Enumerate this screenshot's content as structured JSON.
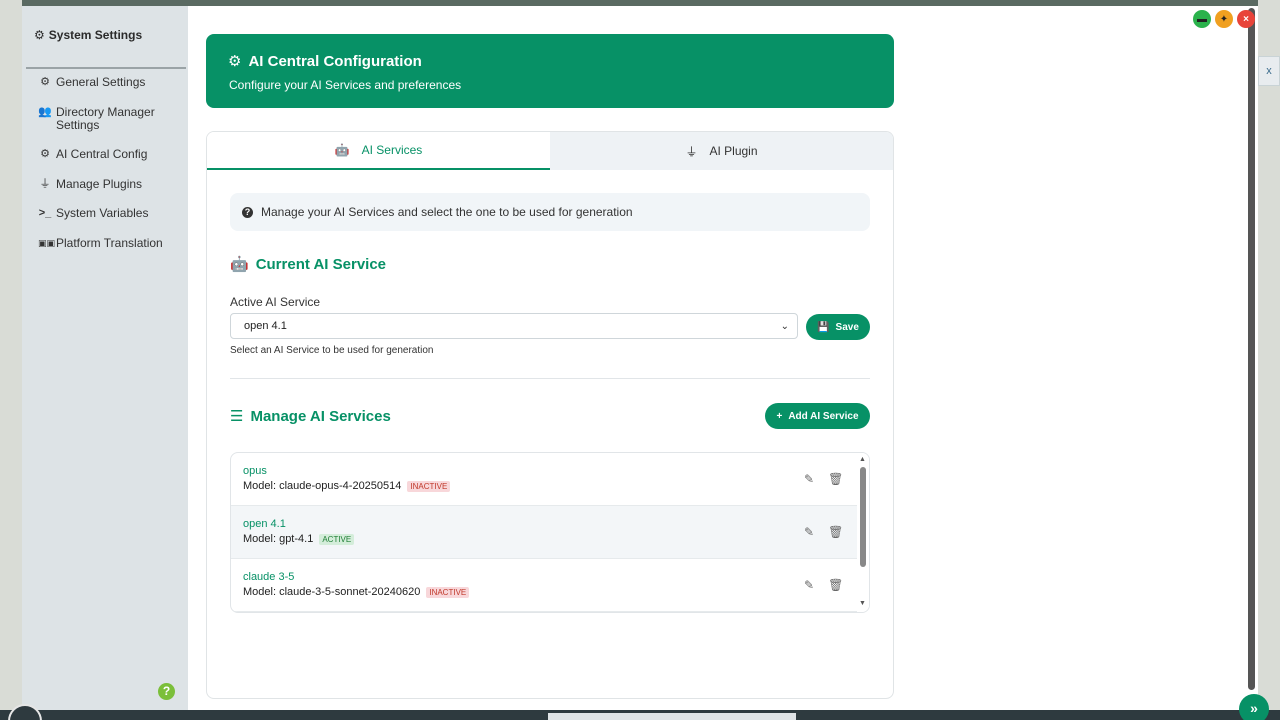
{
  "window": {
    "minimize_icon": "minimize-icon",
    "pin_icon": "pin-icon",
    "close_glyph": "×"
  },
  "background": {
    "right_tab_label": "x"
  },
  "sidebar": {
    "title": "System Settings",
    "items": [
      {
        "label": "General Settings",
        "icon": "gear-icon"
      },
      {
        "label": "Directory Manager Settings",
        "icon": "users-cog-icon"
      },
      {
        "label": "AI Central Config",
        "icon": "gear-icon"
      },
      {
        "label": "Manage Plugins",
        "icon": "plug-icon"
      },
      {
        "label": "System Variables",
        "icon": "terminal-icon"
      },
      {
        "label": "Platform Translation",
        "icon": "language-icon"
      }
    ],
    "help_glyph": "?"
  },
  "header": {
    "title": "AI Central Configuration",
    "subtitle": "Configure your AI Services and preferences"
  },
  "tabs": [
    {
      "label": "AI Services",
      "icon": "robot-icon",
      "active": true
    },
    {
      "label": "AI Plugin",
      "icon": "plug-icon",
      "active": false
    }
  ],
  "info": {
    "text": "Manage your AI Services and select the one to be used for generation"
  },
  "current_service": {
    "title": "Current AI Service",
    "field_label": "Active AI Service",
    "selected": "open 4.1",
    "help": "Select an AI Service to be used for generation",
    "save_label": "Save"
  },
  "manage": {
    "title": "Manage AI Services",
    "add_label": "Add AI Service"
  },
  "services": [
    {
      "name": "opus",
      "model": "Model: claude-opus-4-20250514",
      "status": "INACTIVE"
    },
    {
      "name": "open 4.1",
      "model": "Model: gpt-4.1",
      "status": "ACTIVE"
    },
    {
      "name": "claude 3-5",
      "model": "Model: claude-3-5-sonnet-20240620",
      "status": "INACTIVE"
    }
  ],
  "colors": {
    "brand": "#079166",
    "active_badge_bg": "#d4edda",
    "inactive_badge_bg": "#f8d7da"
  }
}
